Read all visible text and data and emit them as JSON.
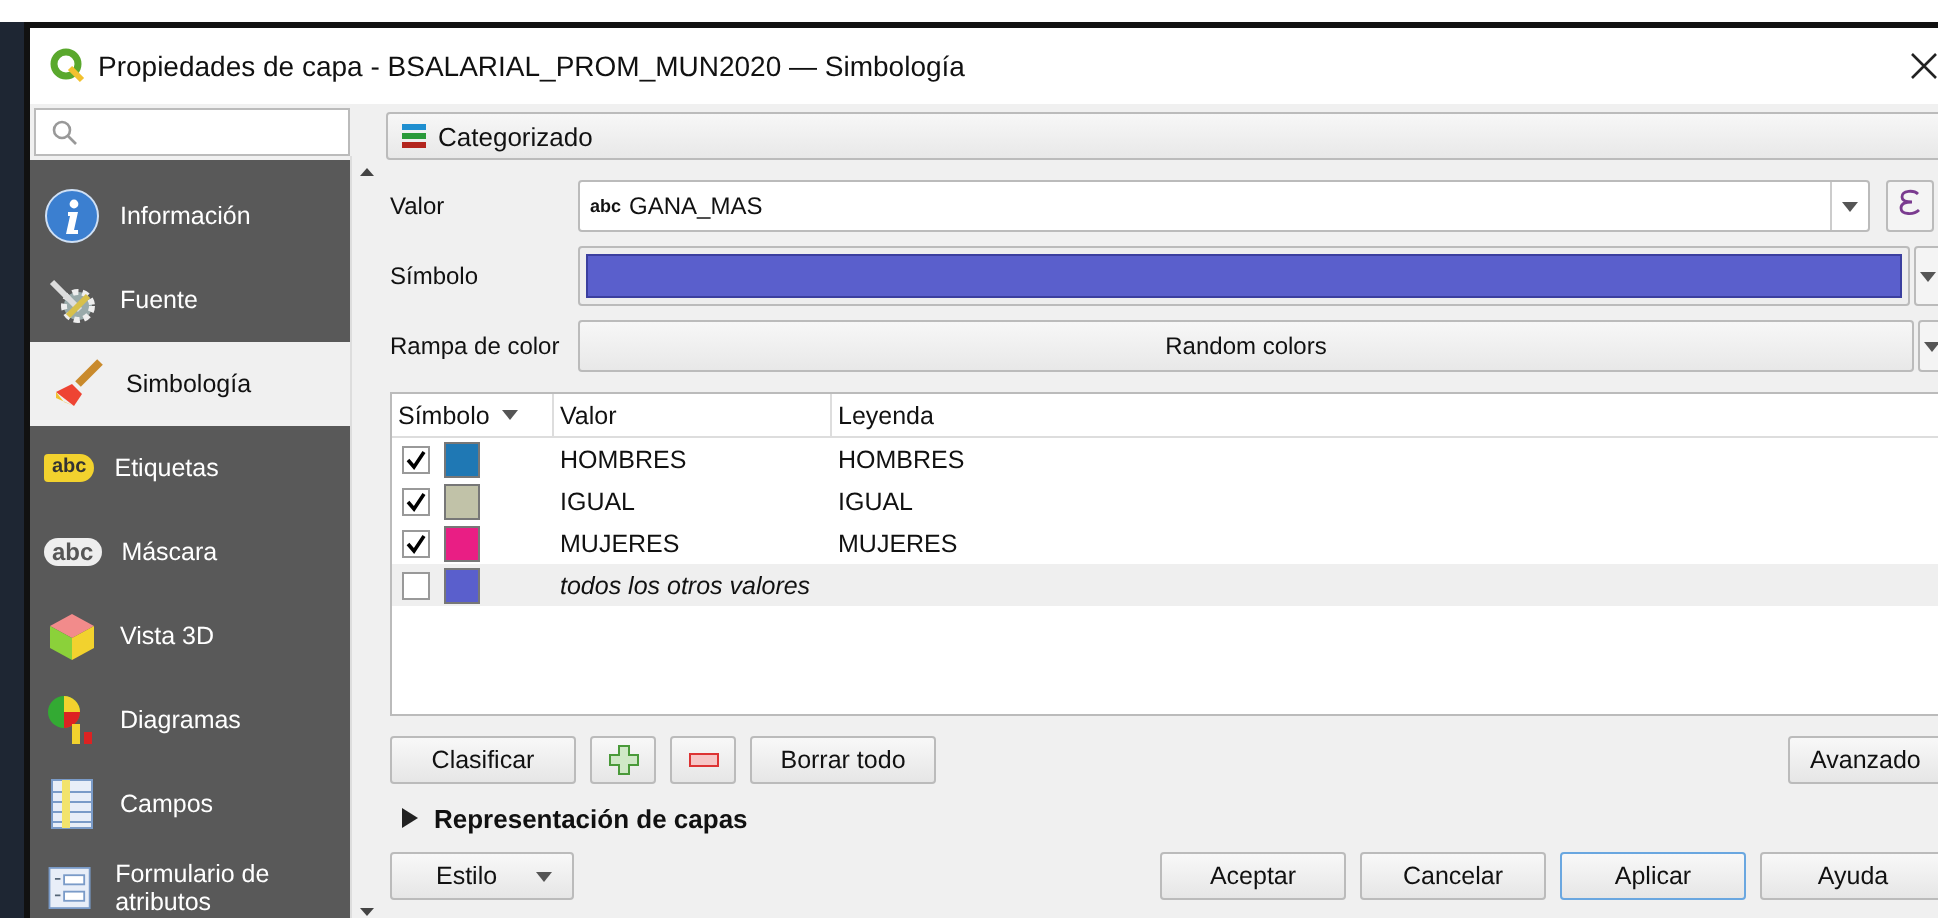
{
  "window": {
    "title": "Propiedades de capa - BSALARIAL_PROM_MUN2020 — Simbología"
  },
  "sidebar": {
    "items": [
      {
        "label": "Información",
        "kind": "info",
        "selected": false
      },
      {
        "label": "Fuente",
        "kind": "source",
        "selected": false
      },
      {
        "label": "Simbología",
        "kind": "brush",
        "selected": true
      },
      {
        "label": "Etiquetas",
        "kind": "label",
        "badge": "abc",
        "selected": false
      },
      {
        "label": "Máscara",
        "kind": "mask",
        "badge": "abc",
        "selected": false
      },
      {
        "label": "Vista 3D",
        "kind": "cube",
        "selected": false
      },
      {
        "label": "Diagramas",
        "kind": "diagram",
        "selected": false
      },
      {
        "label": "Campos",
        "kind": "fields",
        "selected": false
      },
      {
        "label": "Formulario de atributos",
        "kind": "form",
        "selected": false
      }
    ]
  },
  "renderer": {
    "value": "Categorizado"
  },
  "value_field": {
    "label": "Valor",
    "type_badge": "abc",
    "value": "GANA_MAS"
  },
  "symbol": {
    "label": "Símbolo"
  },
  "color_ramp": {
    "label": "Rampa de color",
    "value": "Random colors"
  },
  "table": {
    "columns": [
      "Símbolo",
      "Valor",
      "Leyenda"
    ],
    "rows": [
      {
        "kind": "category",
        "checked": true,
        "color": "#1f78b4",
        "value": "HOMBRES",
        "legend": "HOMBRES",
        "selected": false
      },
      {
        "kind": "category",
        "checked": true,
        "color": "#c1c2a8",
        "value": "IGUAL",
        "legend": "IGUAL",
        "selected": false
      },
      {
        "kind": "category",
        "checked": true,
        "color": "#e91e84",
        "value": "MUJERES",
        "legend": "MUJERES",
        "selected": false
      },
      {
        "kind": "other",
        "checked": false,
        "color": "#5a5fcc",
        "value": "todos los otros valores",
        "selected": true
      }
    ]
  },
  "actions": {
    "classify": "Clasificar",
    "delete_all": "Borrar todo",
    "advanced": "Avanzado"
  },
  "layer_rendering": {
    "label": "Representación de capas",
    "expanded": false
  },
  "style_menu": "Estilo",
  "footer_buttons": [
    {
      "label": "Aceptar",
      "focused": false
    },
    {
      "label": "Cancelar",
      "focused": false
    },
    {
      "label": "Aplicar",
      "focused": true
    },
    {
      "label": "Ayuda",
      "focused": false
    }
  ]
}
